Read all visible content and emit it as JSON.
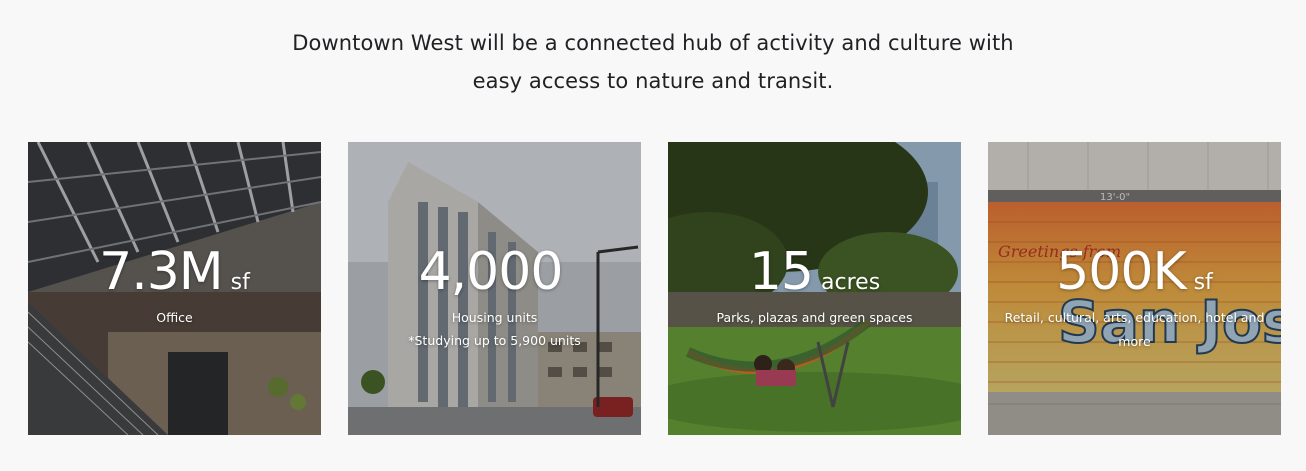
{
  "intro": {
    "line1": "Downtown West will be a connected hub of activity and culture with",
    "line2": "easy access to nature and transit."
  },
  "cards": [
    {
      "value": "7.3M",
      "unit": "sf",
      "label": "Office",
      "note": ""
    },
    {
      "value": "4,000",
      "unit": "",
      "label": "Housing units",
      "note": "*Studying up to 5,900 units"
    },
    {
      "value": "15",
      "unit": "acres",
      "label": "Parks, plazas and green spaces",
      "note": ""
    },
    {
      "value": "500K",
      "unit": "sf",
      "label": "Retail, cultural, arts, education, hotel and more",
      "note": ""
    }
  ],
  "mural": {
    "header": "13'-0\"",
    "greeting": "Greetings from",
    "title": "San Jose"
  },
  "colors": {
    "background": "#f8f8f8",
    "text": "#202124",
    "overlay_text": "#ffffff"
  }
}
